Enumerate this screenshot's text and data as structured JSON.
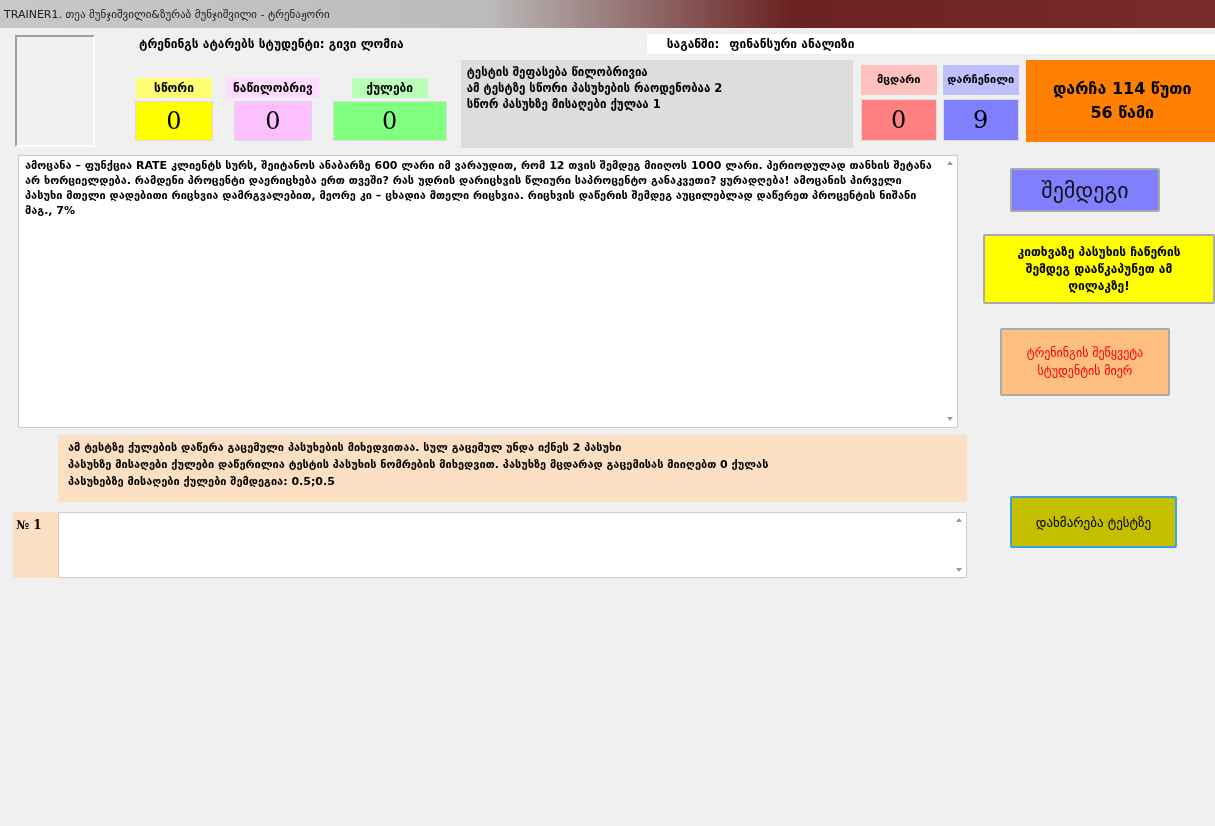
{
  "window": {
    "title": "TRAINER1. თეა მუნჯიშვილი&ზურაბ მუნჯიშვილი - ტრენაჟორი"
  },
  "student": "ტრენინგს ატარებს სტუდენტი: გივი ლომია",
  "subject": {
    "label": "საგანში:",
    "value": "ფინანსური ანალიზი"
  },
  "counters": [
    {
      "label": "სწორი",
      "value": "0",
      "color": "#ffff00"
    },
    {
      "label": "ნაწილობრივ",
      "value": "0",
      "color": "#ffc0ff"
    },
    {
      "label": "ქულები",
      "value": "0",
      "color": "#80ff80"
    }
  ],
  "test_info": [
    "ტესტის შეფასება წილობრივია",
    "ამ ტესტზე სწორი პასუხების რაოდენობაა 2",
    "სწორ პასუხზე მისაღები ქულაა 1"
  ],
  "results": [
    {
      "label": "მცდარი",
      "value": "0",
      "color": "#ff8080"
    },
    {
      "label": "დარჩენილი",
      "value": "9",
      "color": "#8080ff"
    }
  ],
  "timer": [
    "დარჩა 114 წუთი",
    "56 წამი"
  ],
  "question": "ამოცანა – ფუნქცია RATE  კლიენტს სურს, შეიტანოს ანაბარზე 600 ლარი იმ ვარაუდით, რომ  12 თვის შემდეგ მიიღოს 1000 ლარი.  პერიოდულად თანხის შეტანა არ ხორციელდება. რამდენი პროცენტი დაერიცხება ერთ თვეში?  რას უდრის დარიცხვის წლიური საპროცენტო განაკვეთი? ყურადღება! ამოცანის პირველი პასუხი მთელი დადებითი რიცხვია დამრგვალებით, მეორე კი – ცხადია მთელი რიცხვია.   რიცხვის დაწერის შემდეგ აუცილებლად დაწერეთ პროცენტის ნიშანი მაგ., 7%",
  "note": [
    "ამ ტესტზე ქულების დაწერა გაცემული პასუხების მიხედვითაა. სულ გაცემულ უნდა იქნეს 2 პასუხი",
    "პასუხზე მისაღები ქულები დაწერილია ტესტის პასუხის ნომრების მიხედვით. პასუხზე მცდარად გაცემისას მიიღებთ 0 ქულას",
    "პასუხებზე მისაღები ქულები შემდეგია: 0.5;0.5"
  ],
  "answer": {
    "label": "№ 1"
  },
  "buttons": [
    {
      "kind": "next",
      "label": "შემდეგი"
    },
    {
      "kind": "submit",
      "label": "კითხვაზე პასუხის ჩაწერის შემდეგ დააწკაპუნეთ ამ ღილაკზე!"
    },
    {
      "kind": "stop",
      "label": "ტრენინგის შეწყვეტა სტუდენტის მიერ"
    },
    {
      "kind": "help",
      "label": "დახმარება ტესტზე"
    }
  ]
}
